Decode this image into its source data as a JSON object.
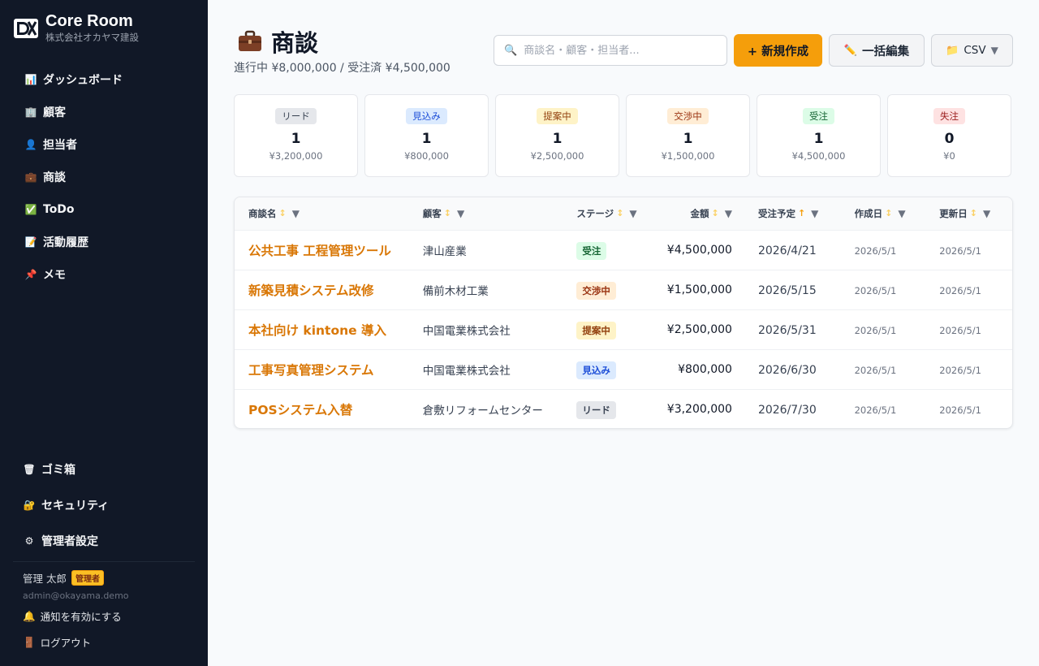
{
  "app": {
    "title": "Core Room",
    "company": "株式会社オカヤマ建設"
  },
  "sidebar": {
    "items": [
      {
        "label": "ダッシュボード",
        "icon": "chart-icon",
        "glyph": "📊"
      },
      {
        "label": "顧客",
        "icon": "building-icon",
        "glyph": "🏢"
      },
      {
        "label": "担当者",
        "icon": "person-icon",
        "glyph": "👤"
      },
      {
        "label": "商談",
        "icon": "briefcase-icon",
        "glyph": "💼"
      },
      {
        "label": "ToDo",
        "icon": "checkbox-icon",
        "glyph": "✅"
      },
      {
        "label": "活動履歴",
        "icon": "memo-icon",
        "glyph": "📝"
      },
      {
        "label": "メモ",
        "icon": "pin-icon",
        "glyph": "📌"
      }
    ],
    "bottom_items": [
      {
        "label": "ゴミ箱",
        "icon": "trash-icon",
        "glyph": "🗑"
      },
      {
        "label": "セキュリティ",
        "icon": "lock-icon",
        "glyph": "🔐"
      },
      {
        "label": "管理者設定",
        "icon": "gear-icon",
        "glyph": "⚙"
      }
    ],
    "user": {
      "name": "管理 太郎",
      "role": "管理者",
      "email": "admin@okayama.demo"
    },
    "notify_label": "通知を有効にする",
    "logout_label": "ログアウト"
  },
  "header": {
    "title": "商談",
    "summary": "進行中 ¥8,000,000 / 受注済 ¥4,500,000",
    "search_placeholder": "商談名・顧客・担当者...",
    "new_label": "+ 新規作成",
    "bulk_edit_label": "一括編集",
    "csv_label": "CSV"
  },
  "stages": [
    {
      "label": "リード",
      "count": "1",
      "amount": "¥3,200,000",
      "bg": "#e5e7eb",
      "fg": "#374151"
    },
    {
      "label": "見込み",
      "count": "1",
      "amount": "¥800,000",
      "bg": "#dbeafe",
      "fg": "#1d4ed8"
    },
    {
      "label": "提案中",
      "count": "1",
      "amount": "¥2,500,000",
      "bg": "#fef3c7",
      "fg": "#92400e"
    },
    {
      "label": "交渉中",
      "count": "1",
      "amount": "¥1,500,000",
      "bg": "#ffedd5",
      "fg": "#9a3412"
    },
    {
      "label": "受注",
      "count": "1",
      "amount": "¥4,500,000",
      "bg": "#dcfce7",
      "fg": "#166534"
    },
    {
      "label": "失注",
      "count": "0",
      "amount": "¥0",
      "bg": "#fee2e2",
      "fg": "#991b1b"
    }
  ],
  "table": {
    "columns": [
      "商談名",
      "顧客",
      "ステージ",
      "金額",
      "受注予定",
      "作成日",
      "更新日"
    ],
    "rows": [
      {
        "name": "公共工事 工程管理ツール",
        "customer": "津山産業",
        "stage": "受注",
        "amount": "¥4,500,000",
        "due": "2026/4/21",
        "created": "2026/5/1",
        "updated": "2026/5/1"
      },
      {
        "name": "新築見積システム改修",
        "customer": "備前木材工業",
        "stage": "交渉中",
        "amount": "¥1,500,000",
        "due": "2026/5/15",
        "created": "2026/5/1",
        "updated": "2026/5/1"
      },
      {
        "name": "本社向け kintone 導入",
        "customer": "中国電業株式会社",
        "stage": "提案中",
        "amount": "¥2,500,000",
        "due": "2026/5/31",
        "created": "2026/5/1",
        "updated": "2026/5/1"
      },
      {
        "name": "工事写真管理システム",
        "customer": "中国電業株式会社",
        "stage": "見込み",
        "amount": "¥800,000",
        "due": "2026/6/30",
        "created": "2026/5/1",
        "updated": "2026/5/1"
      },
      {
        "name": "POSシステム入替",
        "customer": "倉敷リフォームセンター",
        "stage": "リード",
        "amount": "¥3,200,000",
        "due": "2026/7/30",
        "created": "2026/5/1",
        "updated": "2026/5/1"
      }
    ]
  },
  "colors": {
    "sidebar_bg": "#111827",
    "accent": "#f59e0b",
    "link": "#d97706"
  }
}
